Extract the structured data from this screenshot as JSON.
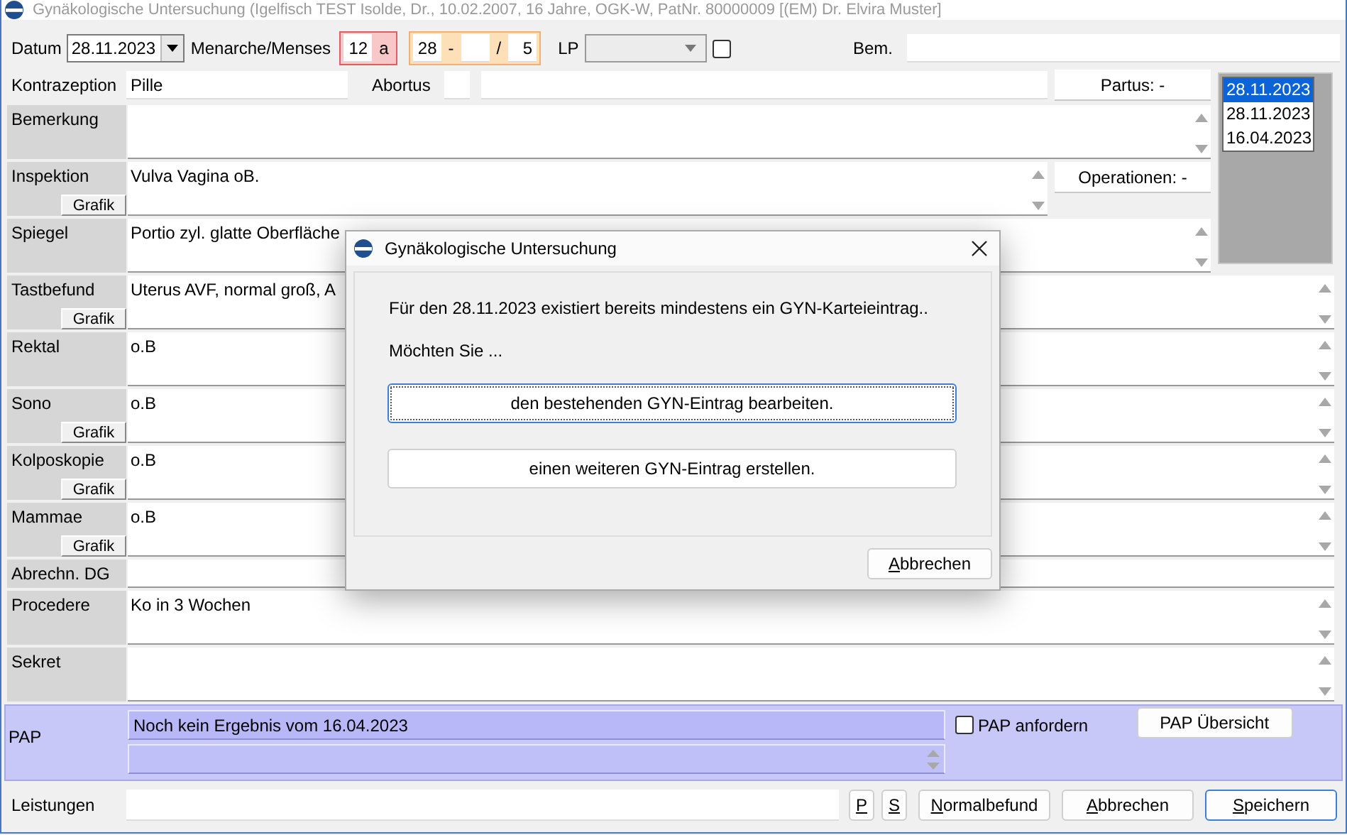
{
  "window": {
    "title": "Gynäkologische Untersuchung (Igelfisch TEST Isolde, Dr., 10.02.2007, 16 Jahre, OGK-W, PatNr. 80000009 [(EM) Dr. Elvira Muster]"
  },
  "header": {
    "date_label": "Datum",
    "date": "28.11.2023",
    "menarche_label": "Menarche/Menses",
    "menarche": "12",
    "menarche_unit": "a",
    "cycle": "28",
    "cycle_sep": "-",
    "cycle_slash": "/",
    "duration": "5",
    "lp_label": "LP",
    "lp_checked": false,
    "bem_label": "Bem."
  },
  "contraception": {
    "label": "Kontrazeption",
    "value": "Pille",
    "abortus_label": "Abortus",
    "partus": "Partus: -"
  },
  "dates": [
    {
      "text": "28.11.2023",
      "selected": true
    },
    {
      "text": "28.11.2023",
      "selected": false
    },
    {
      "text": "16.04.2023",
      "selected": false
    }
  ],
  "sections": [
    {
      "label": "Bemerkung",
      "kind": "memo"
    },
    {
      "label": "Inspektion",
      "kind": "memo",
      "value": "Vulva Vagina oB.",
      "grafik": "Grafik",
      "side_button": "Operationen: -"
    },
    {
      "label": "Spiegel",
      "kind": "memo",
      "value": "Portio zyl. glatte Oberfläche"
    },
    {
      "label": "Tastbefund",
      "kind": "memo",
      "value": "Uterus AVF, normal groß, A",
      "grafik": "Grafik"
    },
    {
      "label": "Rektal",
      "kind": "memo",
      "value": "o.B"
    },
    {
      "label": "Sono",
      "kind": "memo",
      "value": "o.B",
      "grafik": "Grafik"
    },
    {
      "label": "Kolposkopie",
      "kind": "memo",
      "value": "o.B",
      "grafik": "Grafik"
    },
    {
      "label": "Mammae",
      "kind": "memo",
      "value": "o.B",
      "grafik": "Grafik"
    },
    {
      "label": "Abrechn. DG",
      "kind": "line"
    },
    {
      "label": "Procedere",
      "kind": "memo",
      "value": "Ko in 3 Wochen"
    },
    {
      "label": "Sekret",
      "kind": "memo"
    }
  ],
  "pap": {
    "label": "PAP",
    "result": "Noch kein Ergebnis vom 16.04.2023",
    "request_label": "PAP anfordern",
    "request_checked": false,
    "overview": "PAP Übersicht"
  },
  "footer": {
    "label": "Leistungen",
    "buttons": [
      {
        "text": "P",
        "kind": "small",
        "default": false
      },
      {
        "text": "S",
        "kind": "small",
        "default": false
      },
      {
        "text": "Normalbefund",
        "kind": "wide",
        "default": false
      },
      {
        "text": "Abbrechen",
        "kind": "wide",
        "default": false
      },
      {
        "text": "Speichern",
        "kind": "wide",
        "default": true
      }
    ]
  },
  "dialog": {
    "title": "Gynäkologische Untersuchung",
    "message": "Für den 28.11.2023 existiert bereits mindestens ein GYN-Karteieintrag..",
    "question": "Möchten Sie ...",
    "options": [
      {
        "text": "den bestehenden GYN-Eintrag bearbeiten.",
        "focused": true
      },
      {
        "text": "einen weiteren GYN-Eintrag erstellen.",
        "focused": false
      }
    ],
    "cancel": "Abbrechen"
  }
}
